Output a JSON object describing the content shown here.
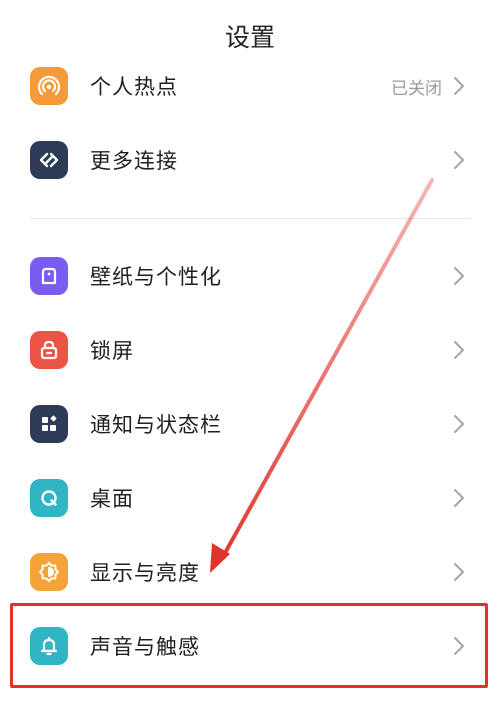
{
  "header": {
    "title": "设置"
  },
  "settings": {
    "hotspot": {
      "label": "个人热点",
      "status": "已关闭",
      "icon": "hotspot-icon",
      "color": "#f39a3a"
    },
    "more_connections": {
      "label": "更多连接",
      "icon": "link-icon",
      "color": "#2e3b56"
    },
    "wallpaper": {
      "label": "壁纸与个性化",
      "icon": "theme-icon",
      "color": "#7b5cf0"
    },
    "lockscreen": {
      "label": "锁屏",
      "icon": "lock-icon",
      "color": "#ec5546"
    },
    "notifications": {
      "label": "通知与状态栏",
      "icon": "grid-icon",
      "color": "#2e3b56"
    },
    "desktop": {
      "label": "桌面",
      "icon": "home-icon",
      "color": "#2fb5c3"
    },
    "display": {
      "label": "显示与亮度",
      "icon": "brightness-icon",
      "color": "#f3a338"
    },
    "sound": {
      "label": "声音与触感",
      "icon": "bell-icon",
      "color": "#2fb5c3"
    }
  },
  "annotation": {
    "color": "#e1332b",
    "icon": "red-arrow-annotation"
  }
}
